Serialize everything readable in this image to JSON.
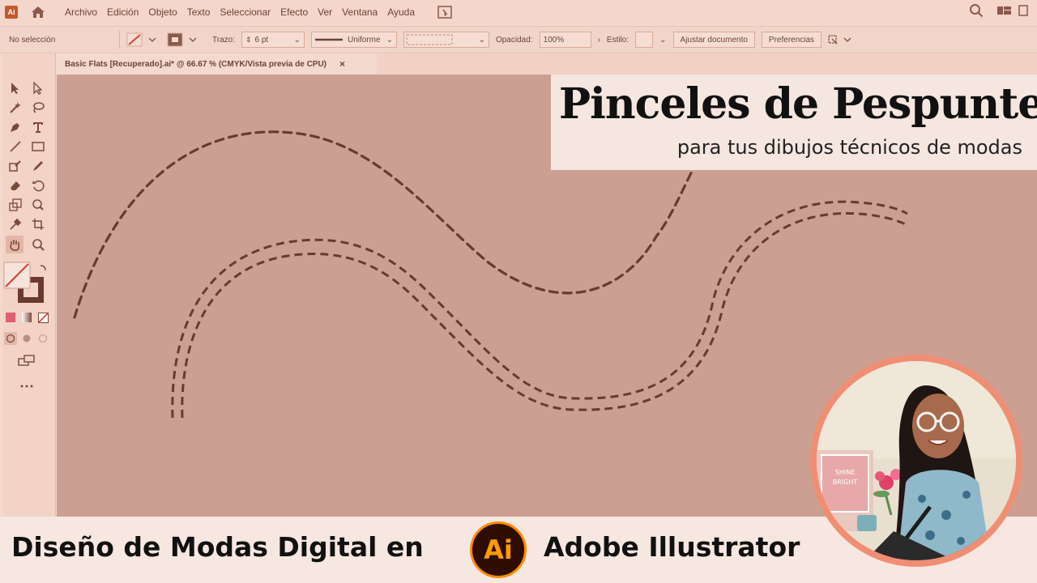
{
  "app": {
    "logo_text": "Ai"
  },
  "menu": {
    "items": [
      "Archivo",
      "Edición",
      "Objeto",
      "Texto",
      "Seleccionar",
      "Efecto",
      "Ver",
      "Ventana",
      "Ayuda"
    ]
  },
  "control": {
    "selection": "No selección",
    "stroke_label": "Trazo:",
    "stroke_value": "6 pt",
    "profile": "Uniforme",
    "opacity_label": "Opacidad:",
    "opacity_value": "100%",
    "style_label": "Estilo:",
    "fit_button": "Ajustar documento",
    "prefs_button": "Preferencias"
  },
  "document": {
    "tab_title": "Basic Flats [Recuperado].ai* @ 66.67 % (CMYK/Vista previa de CPU)",
    "close": "×"
  },
  "title_card": {
    "title": "Pinceles de Pespuntes",
    "subtitle": "para tus dibujos técnicos de modas"
  },
  "banner": {
    "left_text": "Diseño de Modas Digital en",
    "badge_text": "Ai",
    "right_text": "Adobe Illustrator"
  },
  "avatar": {
    "sign_text": "SHINE BRIGHT"
  },
  "colors": {
    "canvas": "#cba093",
    "stitch": "#6b3a2e",
    "accent": "#f08e74",
    "ai_orange": "#ff9a00",
    "ai_dark": "#2e0d01"
  },
  "icons": [
    "home-icon",
    "arrange-documents-icon",
    "search-icon",
    "workspace-icon",
    "selection-tool-icon",
    "direct-selection-tool-icon",
    "magic-wand-icon",
    "lasso-icon",
    "pen-icon",
    "type-icon",
    "line-icon",
    "rectangle-icon",
    "shaper-icon",
    "pencil-icon",
    "eraser-icon",
    "rotate-icon",
    "scale-icon",
    "warp-icon",
    "eyedropper-icon",
    "crop-icon",
    "hand-icon",
    "zoom-icon",
    "more-tools-icon"
  ]
}
